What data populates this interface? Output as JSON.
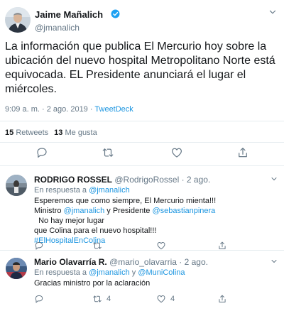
{
  "main_tweet": {
    "author": {
      "name": "Jaime Mañalich",
      "handle": "@jmanalich"
    },
    "text": "La información que publica El Mercurio hoy sobre la ubicación del nuevo hospital Metropolitano Norte está equivocada. EL Presidente anunciará el lugar el miércoles.",
    "time": "9:09 a. m. · 2 ago. 2019 · ",
    "client": "TweetDeck",
    "stats": {
      "retweets_count": "15",
      "retweets_label": "Retweets",
      "likes_count": "13",
      "likes_label": "Me gusta"
    }
  },
  "replies": [
    {
      "name": "RODRIGO ROSSEL",
      "handle": "@RodrigoRossel · 2 ago.",
      "reply_prefix": "En respuesta a ",
      "reply_to": "@jmanalich",
      "body_line1": "Esperemos que como siempre, El Mercurio mienta!!!",
      "body_line2_a": "Ministro ",
      "body_line2_mention1": "@jmanalich",
      "body_line2_b": " y Presidente ",
      "body_line2_mention2": "@sebastianpinera",
      "body_line2_c": "  No hay mejor lugar",
      "body_line3": "que Colina para el nuevo hospital!!!",
      "hashtag": "#ElHospitalEnColina"
    },
    {
      "name": "Mario Olavarría R.",
      "handle": "@mario_olavarria · 2 ago.",
      "reply_prefix": "En respuesta a ",
      "reply_to_1": "@jmanalich",
      "reply_and": " y ",
      "reply_to_2": "@MuniColina",
      "body": "Gracias ministro por la aclaración",
      "retweets": "4",
      "likes": "4"
    }
  ],
  "colors": {
    "accent": "#1b95e0",
    "text": "#14171a",
    "muted": "#657786",
    "divider": "#e6ecf0"
  },
  "icons": [
    "verified-badge-icon",
    "chevron-down-icon",
    "reply-icon",
    "retweet-icon",
    "like-icon",
    "share-icon"
  ]
}
